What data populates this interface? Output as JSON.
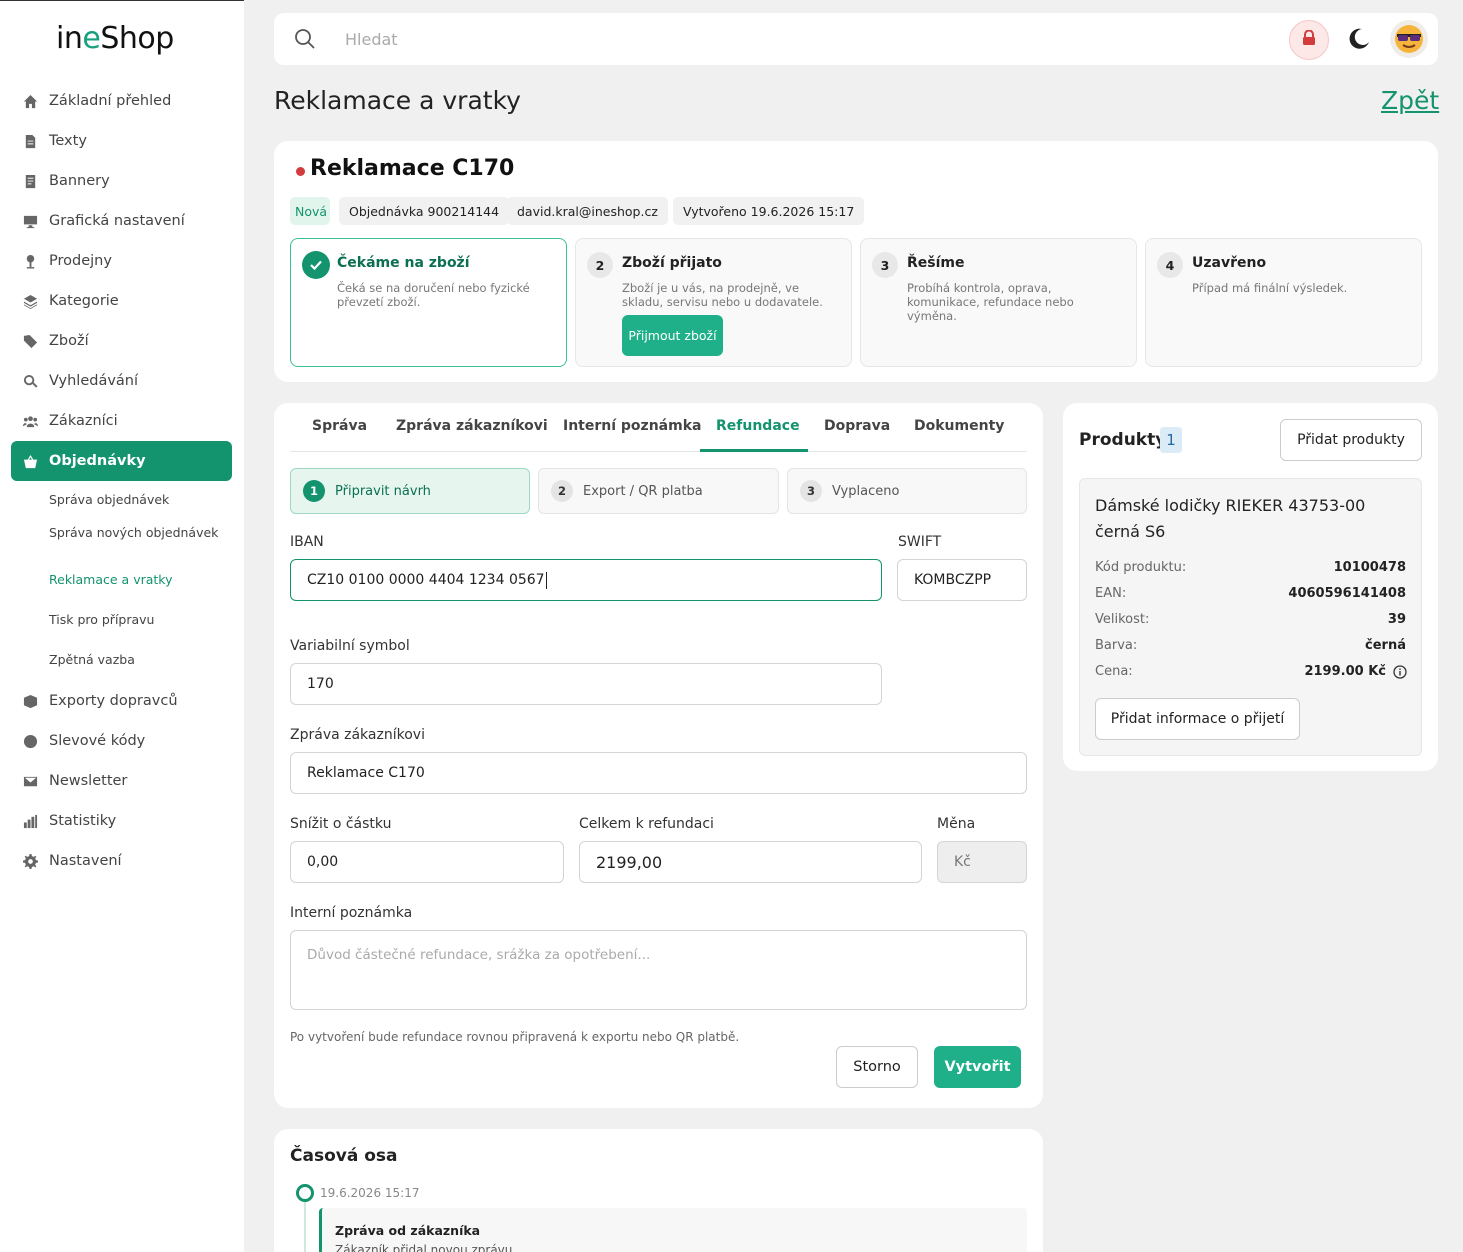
{
  "brand": {
    "logo_prefix": "in",
    "logo_mid": "e",
    "logo_suffix": "Shop"
  },
  "sidebar": {
    "items": [
      {
        "label": "Základní přehled",
        "icon": "home-icon"
      },
      {
        "label": "Texty",
        "icon": "document-icon"
      },
      {
        "label": "Bannery",
        "icon": "banner-icon"
      },
      {
        "label": "Grafická nastavení",
        "icon": "monitor-icon"
      },
      {
        "label": "Prodejny",
        "icon": "location-icon"
      },
      {
        "label": "Kategorie",
        "icon": "layers-icon"
      },
      {
        "label": "Zboží",
        "icon": "tag-icon"
      },
      {
        "label": "Vyhledávání",
        "icon": "search-icon"
      },
      {
        "label": "Zákazníci",
        "icon": "users-icon"
      },
      {
        "label": "Objednávky",
        "icon": "basket-icon"
      },
      {
        "label": "Exporty dopravců",
        "icon": "box-icon"
      },
      {
        "label": "Slevové kódy",
        "icon": "discount-icon"
      },
      {
        "label": "Newsletter",
        "icon": "mail-icon"
      },
      {
        "label": "Statistiky",
        "icon": "chart-icon"
      },
      {
        "label": "Nastavení",
        "icon": "gear-icon"
      }
    ],
    "sub_items": [
      "Správa objednávek",
      "Správa nových objednávek",
      "Reklamace a vratky",
      "Tisk pro přípravu",
      "Zpětná vazba"
    ]
  },
  "topbar": {
    "search_placeholder": "Hledat"
  },
  "page": {
    "title": "Reklamace a vratky",
    "back_label": "Zpět"
  },
  "claim": {
    "title": "Reklamace C170",
    "status": "Nová",
    "order": "Objednávka 900214144",
    "email": "david.kral@ineshop.cz",
    "created": "Vytvořeno 19.6.2026 15:17",
    "steps": [
      {
        "num": "",
        "title": "Čekáme na zboží",
        "desc": "Čeká se na doručení nebo fyzické převzetí zboží."
      },
      {
        "num": "2",
        "title": "Zboží přijato",
        "desc": "Zboží je u vás, na prodejně, ve skladu, servisu nebo u dodavatele.",
        "button": "Přijmout zboží"
      },
      {
        "num": "3",
        "title": "Řešíme",
        "desc": "Probíhá kontrola, oprava, komunikace, refundace nebo výměna."
      },
      {
        "num": "4",
        "title": "Uzavřeno",
        "desc": "Případ má finální výsledek."
      }
    ]
  },
  "tabs": [
    "Správa",
    "Zpráva zákazníkovi",
    "Interní poznámka",
    "Refundace",
    "Doprava",
    "Dokumenty"
  ],
  "refund": {
    "substeps": [
      {
        "num": "1",
        "label": "Připravit návrh"
      },
      {
        "num": "2",
        "label": "Export / QR platba"
      },
      {
        "num": "3",
        "label": "Vyplaceno"
      }
    ],
    "iban_label": "IBAN",
    "iban_value": "CZ10 0100 0000 4404 1234 0567",
    "swift_label": "SWIFT",
    "swift_value": "KOMBCZPP",
    "vs_label": "Variabilní symbol",
    "vs_value": "170",
    "msg_label": "Zpráva zákazníkovi",
    "msg_value": "Reklamace C170",
    "reduce_label": "Snížit o částku",
    "reduce_value": "0,00",
    "total_label": "Celkem k refundaci",
    "total_value": "2199,00",
    "currency_label": "Měna",
    "currency_value": "Kč",
    "note_label": "Interní poznámka",
    "note_placeholder": "Důvod částečné refundace, srážka za opotřebení...",
    "hint": "Po vytvoření bude refundace rovnou připravená k exportu nebo QR platbě.",
    "cancel": "Storno",
    "create": "Vytvořit"
  },
  "products": {
    "title": "Produkty",
    "count": "1",
    "add_button": "Přidat produkty",
    "name": "Dámské lodičky RIEKER 43753-00 černá S6",
    "rows": [
      {
        "k": "Kód produktu:",
        "v": "10100478"
      },
      {
        "k": "EAN:",
        "v": "4060596141408"
      },
      {
        "k": "Velikost:",
        "v": "39"
      },
      {
        "k": "Barva:",
        "v": "černá"
      },
      {
        "k": "Cena:",
        "v": "2199.00 Kč"
      }
    ],
    "receipt_button": "Přidat informace o přijetí"
  },
  "timeline": {
    "title": "Časová osa",
    "date": "19.6.2026 15:17",
    "entry_title": "Zpráva od zákazníka",
    "entry_text": "Zákazník přidal novou zprávu"
  },
  "colors": {
    "accent": "#13936e",
    "accent_light": "#1fb08a",
    "danger": "#d23c3c"
  }
}
